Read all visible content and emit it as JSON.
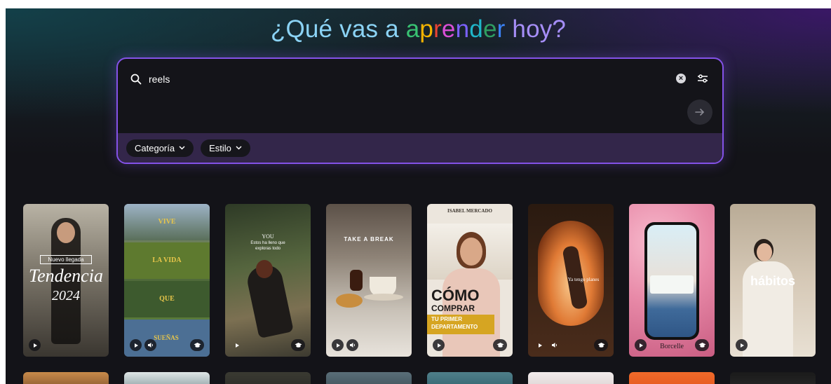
{
  "headline": {
    "part1": "¿Qué vas a ",
    "rainbow_letters": [
      {
        "ch": "a",
        "color": "#38c172"
      },
      {
        "ch": "p",
        "color": "#f4b400"
      },
      {
        "ch": "r",
        "color": "#ea4335"
      },
      {
        "ch": "e",
        "color": "#d94fd6"
      },
      {
        "ch": "n",
        "color": "#7b61ff"
      },
      {
        "ch": "d",
        "color": "#1fb6c9"
      },
      {
        "ch": "e",
        "color": "#2f9e62"
      },
      {
        "ch": "r",
        "color": "#3b82f6"
      }
    ],
    "part3": " hoy?"
  },
  "search": {
    "value": "reels",
    "placeholder": "",
    "clear_icon": "x-circle-icon",
    "filter_icon": "sliders-icon",
    "submit_icon": "arrow-right-icon"
  },
  "filters": [
    {
      "label": "Categoría",
      "icon": "chevron-down-icon"
    },
    {
      "label": "Estilo",
      "icon": "chevron-down-icon"
    }
  ],
  "templates": [
    {
      "texts": [
        "Nuevo llegada",
        "Tendencia",
        "2024"
      ],
      "controls": [
        "play",
        "none"
      ],
      "bg": "#7b7569"
    },
    {
      "texts": [
        "VIVE",
        "LA VIDA",
        "QUE",
        "SUEÑAS"
      ],
      "controls": [
        "play",
        "sound",
        "edu"
      ],
      "bg": "#4f6a3a"
    },
    {
      "texts": [
        "YOU",
        "Estos ha lleno que",
        "exploras todo"
      ],
      "controls": [
        "play",
        "none"
      ],
      "bg": "#4a5a3d"
    },
    {
      "texts": [
        "TAKE A BREAK"
      ],
      "controls": [
        "play",
        "sound"
      ],
      "bg": "#8e8377"
    },
    {
      "texts": [
        "ISABEL MERCADO",
        "CÓMO",
        "COMPRAR",
        "TU PRIMER",
        "DEPARTAMENTO"
      ],
      "controls": [
        "play",
        "edu"
      ],
      "bg": "#ece6dd"
    },
    {
      "texts": [
        "Ya tengo planes"
      ],
      "controls": [
        "play",
        "sound",
        "edu"
      ],
      "bg": "#4a2c1b"
    },
    {
      "texts": [
        "Borcelle"
      ],
      "controls": [
        "play",
        "edu"
      ],
      "bg": "#e88aa8"
    },
    {
      "texts": [
        "hábitos"
      ],
      "controls": [
        "play"
      ],
      "bg": "#d6c9b7"
    }
  ],
  "colors": {
    "accent": "#8452e8",
    "chip_bar": "#33264a",
    "background": "#131318",
    "gold": "#d6a522"
  }
}
